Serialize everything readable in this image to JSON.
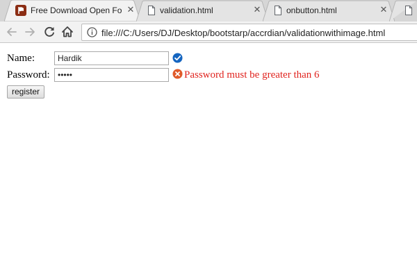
{
  "browser": {
    "tabs": [
      {
        "title": "Free Download Open Fo",
        "favicon": "fontawesome-flag-icon",
        "active": true
      },
      {
        "title": "validation.html",
        "favicon": "page-icon",
        "active": false
      },
      {
        "title": "onbutton.html",
        "favicon": "page-icon",
        "active": false
      },
      {
        "title": "",
        "favicon": "page-icon",
        "active": false
      }
    ],
    "close_glyph": "✕",
    "address": "file:///C:/Users/DJ/Desktop/bootstarp/accrdian/validationwithimage.html"
  },
  "form": {
    "name_label": "Name:",
    "name_value": "Hardik",
    "name_status": "valid-check-icon",
    "password_label": "Password:",
    "password_value": "•••••",
    "password_status": "error-x-icon",
    "password_error": "Password must be greater than 6",
    "register_label": "register"
  },
  "colors": {
    "valid": "#1565c0",
    "error": "#e0231e"
  }
}
